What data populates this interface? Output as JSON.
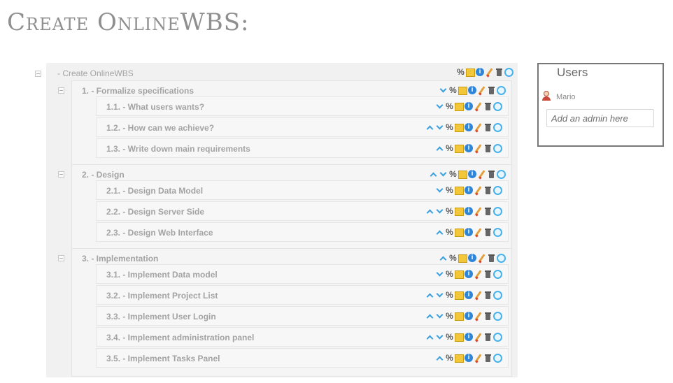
{
  "page": {
    "title": "Create OnlineWBS:"
  },
  "tree": {
    "root": {
      "label": "- Create OnlineWBS",
      "icons": [
        "percent-icon",
        "card-icon",
        "info-icon",
        "pencil-icon",
        "trash-icon",
        "add-icon"
      ]
    },
    "groups": [
      {
        "label": "1. - Formalize specifications",
        "icons": [
          "down-icon",
          "percent-icon",
          "card-icon",
          "info-icon",
          "pencil-icon",
          "trash-icon",
          "add-icon"
        ],
        "children": [
          {
            "label": "1.1. - What users wants?",
            "icons": [
              "down-icon",
              "percent-icon",
              "card-icon",
              "info-icon",
              "pencil-icon",
              "trash-icon",
              "add-icon"
            ]
          },
          {
            "label": "1.2. - How can we achieve?",
            "icons": [
              "up-icon",
              "down-icon",
              "percent-icon",
              "card-icon",
              "info-icon",
              "pencil-icon",
              "trash-icon",
              "add-icon"
            ]
          },
          {
            "label": "1.3. - Write down main requirements",
            "icons": [
              "up-icon",
              "percent-icon",
              "card-icon",
              "info-icon",
              "pencil-icon",
              "trash-icon",
              "add-icon"
            ]
          }
        ]
      },
      {
        "label": "2. - Design",
        "icons": [
          "up-icon",
          "down-icon",
          "percent-icon",
          "card-icon",
          "info-icon",
          "pencil-icon",
          "trash-icon",
          "add-icon"
        ],
        "children": [
          {
            "label": "2.1. - Design Data Model",
            "icons": [
              "down-icon",
              "percent-icon",
              "card-icon",
              "info-icon",
              "pencil-icon",
              "trash-icon",
              "add-icon"
            ]
          },
          {
            "label": "2.2. - Design Server Side",
            "icons": [
              "up-icon",
              "down-icon",
              "percent-icon",
              "card-icon",
              "info-icon",
              "pencil-icon",
              "trash-icon",
              "add-icon"
            ]
          },
          {
            "label": "2.3. - Design Web Interface",
            "icons": [
              "up-icon",
              "percent-icon",
              "card-icon",
              "info-icon",
              "pencil-icon",
              "trash-icon",
              "add-icon"
            ]
          }
        ]
      },
      {
        "label": "3. - Implementation",
        "icons": [
          "up-icon",
          "percent-icon",
          "card-icon",
          "info-icon",
          "pencil-icon",
          "trash-icon",
          "add-icon"
        ],
        "children": [
          {
            "label": "3.1. - Implement Data model",
            "icons": [
              "down-icon",
              "percent-icon",
              "card-icon",
              "info-icon",
              "pencil-icon",
              "trash-icon",
              "add-icon"
            ]
          },
          {
            "label": "3.2. - Implement Project List",
            "icons": [
              "up-icon",
              "down-icon",
              "percent-icon",
              "card-icon",
              "info-icon",
              "pencil-icon",
              "trash-icon",
              "add-icon"
            ]
          },
          {
            "label": "3.3. - Implement User Login",
            "icons": [
              "up-icon",
              "down-icon",
              "percent-icon",
              "card-icon",
              "info-icon",
              "pencil-icon",
              "trash-icon",
              "add-icon"
            ]
          },
          {
            "label": "3.4. - Implement administration panel",
            "icons": [
              "up-icon",
              "down-icon",
              "percent-icon",
              "card-icon",
              "info-icon",
              "pencil-icon",
              "trash-icon",
              "add-icon"
            ]
          },
          {
            "label": "3.5. - Implement Tasks Panel",
            "icons": [
              "up-icon",
              "percent-icon",
              "card-icon",
              "info-icon",
              "pencil-icon",
              "trash-icon",
              "add-icon"
            ]
          }
        ]
      }
    ]
  },
  "users": {
    "title": "Users",
    "list": [
      {
        "name": "Mario",
        "icon": "user-avatar-icon"
      }
    ],
    "add_admin_placeholder": "Add an admin here"
  }
}
